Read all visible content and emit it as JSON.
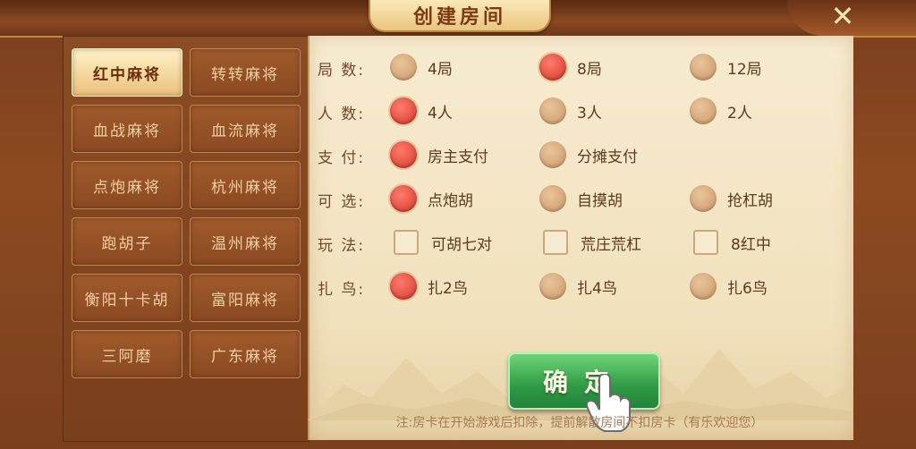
{
  "title": "创建房间",
  "close_label": "✕",
  "game_types": [
    {
      "label": "红中麻将",
      "selected": true
    },
    {
      "label": "转转麻将",
      "selected": false
    },
    {
      "label": "血战麻将",
      "selected": false
    },
    {
      "label": "血流麻将",
      "selected": false
    },
    {
      "label": "点炮麻将",
      "selected": false
    },
    {
      "label": "杭州麻将",
      "selected": false
    },
    {
      "label": "跑胡子",
      "selected": false
    },
    {
      "label": "温州麻将",
      "selected": false
    },
    {
      "label": "衡阳十卡胡",
      "selected": false
    },
    {
      "label": "富阳麻将",
      "selected": false
    },
    {
      "label": "三阿磨",
      "selected": false
    },
    {
      "label": "广东麻将",
      "selected": false
    }
  ],
  "rows": [
    {
      "label": "局 数:",
      "type": "radio",
      "options": [
        {
          "label": "4局",
          "checked": false
        },
        {
          "label": "8局",
          "checked": true
        },
        {
          "label": "12局",
          "checked": false
        }
      ]
    },
    {
      "label": "人 数:",
      "type": "radio",
      "options": [
        {
          "label": "4人",
          "checked": true
        },
        {
          "label": "3人",
          "checked": false
        },
        {
          "label": "2人",
          "checked": false
        }
      ]
    },
    {
      "label": "支 付:",
      "type": "radio",
      "options": [
        {
          "label": "房主支付",
          "checked": true
        },
        {
          "label": "分摊支付",
          "checked": false
        }
      ]
    },
    {
      "label": "可 选:",
      "type": "radio",
      "options": [
        {
          "label": "点炮胡",
          "checked": true
        },
        {
          "label": "自摸胡",
          "checked": false
        },
        {
          "label": "抢杠胡",
          "checked": false
        }
      ]
    },
    {
      "label": "玩 法:",
      "type": "checkbox",
      "options": [
        {
          "label": "可胡七对",
          "checked": false
        },
        {
          "label": "荒庄荒杠",
          "checked": false
        },
        {
          "label": "8红中",
          "checked": false
        }
      ]
    },
    {
      "label": "扎 鸟:",
      "type": "radio",
      "options": [
        {
          "label": "扎2鸟",
          "checked": true
        },
        {
          "label": "扎4鸟",
          "checked": false
        },
        {
          "label": "扎6鸟",
          "checked": false
        }
      ]
    }
  ],
  "confirm_label": "确定",
  "note": "注:房卡在开始游戏后扣除，提前解散房间不扣房卡（有乐欢迎您）",
  "colors": {
    "radio_on": "#d2372a",
    "confirm": "#2f9b45",
    "selected_tab": "#eac17a"
  }
}
